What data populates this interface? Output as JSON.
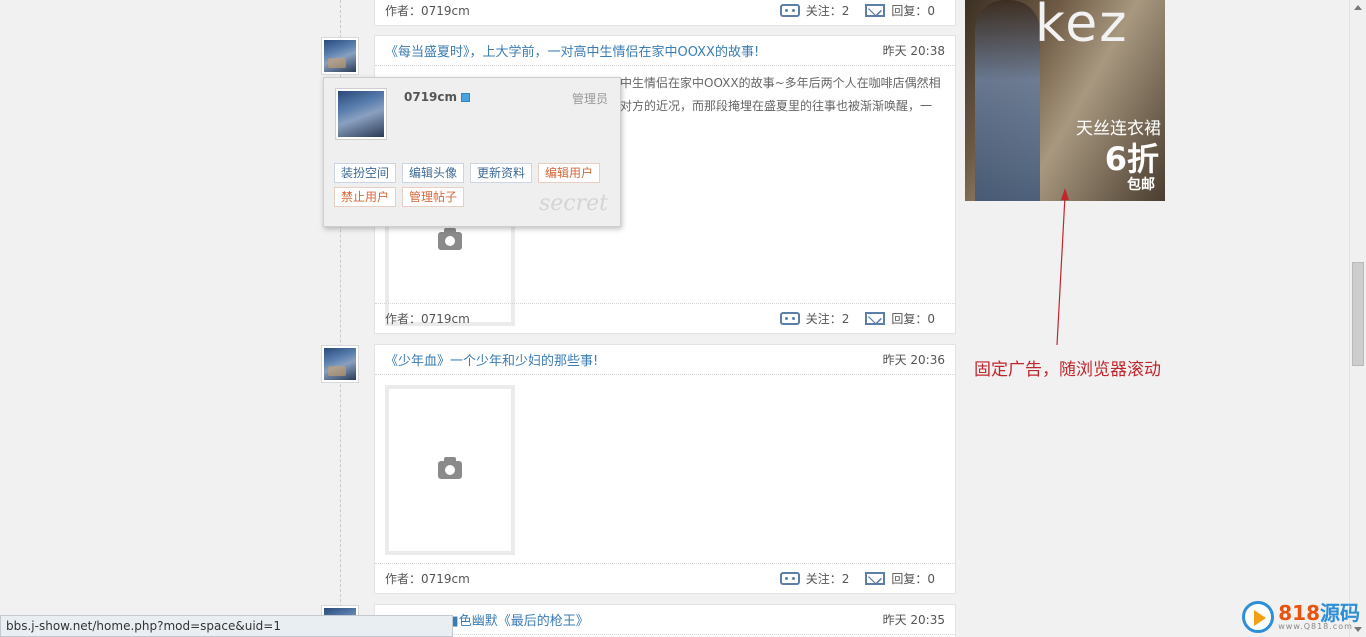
{
  "posts": [
    {
      "title": "",
      "time": "",
      "author": "作者：0719cm",
      "follow": "关注：2",
      "reply": "回复：0"
    },
    {
      "title": "《每当盛夏时》，上大学前，一对高中生情侣在家中OOXX的故事!",
      "time": "昨天 20:38",
      "excerpt1": "中生情侣在家中OOXX的故事~多年后两个人在咖啡店偶然相",
      "excerpt2": "对方的近况，而那段掩埋在盛夏里的往事也被渐渐唤醒，一",
      "author": "作者：0719cm",
      "follow": "关注：2",
      "reply": "回复：0"
    },
    {
      "title": "《少年血》一个少年和少妇的那些事!",
      "time": "昨天 20:36",
      "author": "作者：0719cm",
      "follow": "关注：2",
      "reply": "回复：0"
    },
    {
      "title": "■■■■■■色幽默《最后的枪王》",
      "time": "昨天 20:35"
    }
  ],
  "popup": {
    "username": "0719cm",
    "role": "管理员",
    "actions": [
      "装扮空间",
      "编辑头像",
      "更新资料",
      "编辑用户",
      "禁止用户",
      "管理帖子"
    ],
    "watermark": "secret"
  },
  "ad": {
    "brand": "kez",
    "line1": "天丝连衣裙",
    "line2": "6折",
    "line3": "包邮"
  },
  "annotation": "固定广告，随浏览器滚动",
  "status_url": "bbs.j-show.net/home.php?mod=space&uid=1",
  "logo": {
    "num": "818",
    "name": "源码",
    "site": "www.Q818.com"
  },
  "colors": {
    "link": "#3b7cb3",
    "annotation": "#c0272d",
    "warn": "#d4683b"
  }
}
